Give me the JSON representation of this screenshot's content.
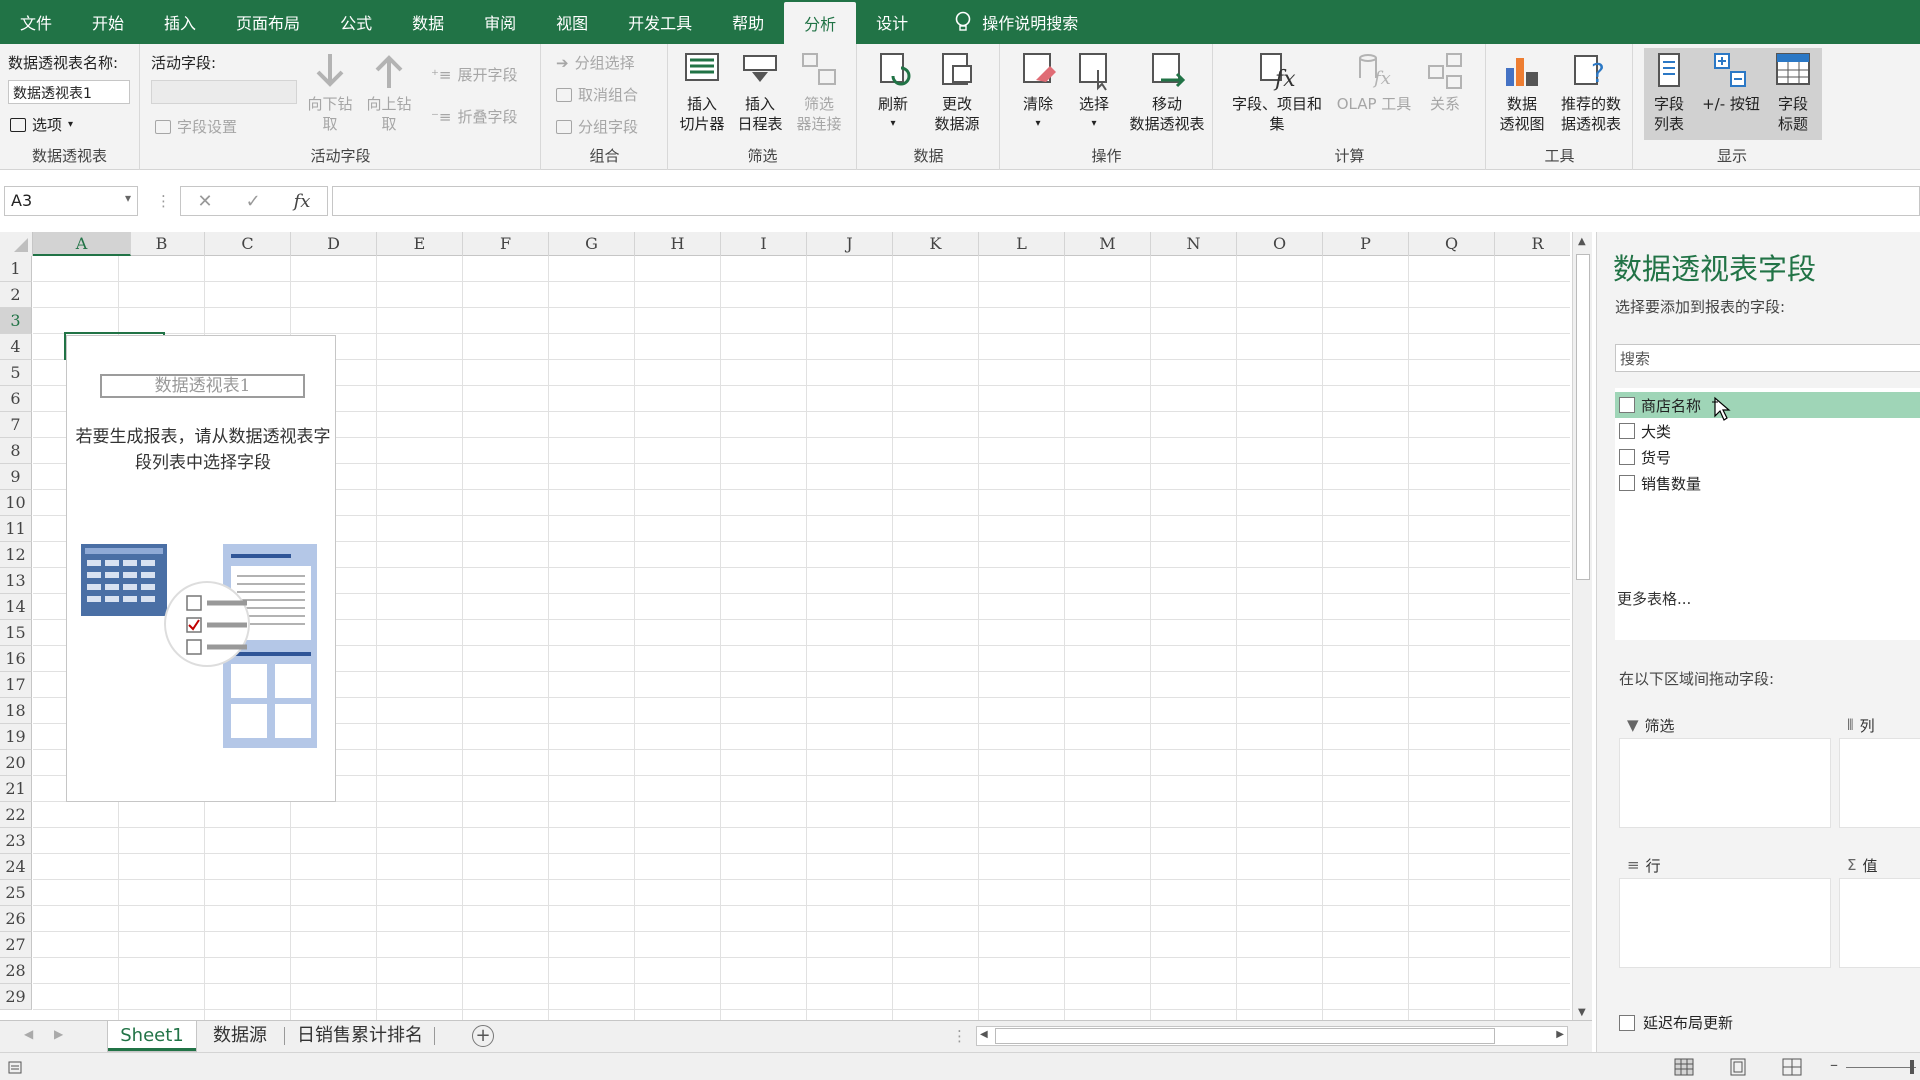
{
  "ribbon_tabs": [
    "文件",
    "开始",
    "插入",
    "页面布局",
    "公式",
    "数据",
    "审阅",
    "视图",
    "开发工具",
    "帮助",
    "分析",
    "设计"
  ],
  "active_tab": "分析",
  "tell_me": "操作说明搜索",
  "groups": {
    "pivot": {
      "label": "数据透视表",
      "name_label": "数据透视表名称:",
      "name_value": "数据透视表1",
      "options": "选项"
    },
    "active_field": {
      "label": "活动字段",
      "field_label": "活动字段:",
      "settings": "字段设置",
      "drill_down": "向下钻取",
      "drill_up_1": "向上钻",
      "drill_up_2": "取",
      "expand": "展开字段",
      "collapse": "折叠字段"
    },
    "group": {
      "label": "组合",
      "group_sel": "分组选择",
      "ungroup": "取消组合",
      "group_field": "分组字段"
    },
    "filter": {
      "label": "筛选",
      "slicer_1": "插入",
      "slicer_2": "切片器",
      "timeline_1": "插入",
      "timeline_2": "日程表",
      "conn_1": "筛选",
      "conn_2": "器连接"
    },
    "data": {
      "label": "数据",
      "refresh": "刷新",
      "change_1": "更改",
      "change_2": "数据源"
    },
    "actions": {
      "label": "操作",
      "clear": "清除",
      "select": "选择",
      "move_1": "移动",
      "move_2": "数据透视表"
    },
    "calc": {
      "label": "计算",
      "fields_1": "字段、项目和",
      "fields_2": "集",
      "olap": "OLAP 工具",
      "rel": "关系"
    },
    "tools": {
      "label": "工具",
      "chart_1": "数据",
      "chart_2": "透视图",
      "rec_1": "推荐的数",
      "rec_2": "据透视表"
    },
    "show": {
      "label": "显示",
      "list_1": "字段",
      "list_2": "列表",
      "btn": "+/- 按钮",
      "hdr_1": "字段",
      "hdr_2": "标题"
    }
  },
  "namebox": "A3",
  "columns": [
    "A",
    "B",
    "C",
    "D",
    "E",
    "F",
    "G",
    "H",
    "I",
    "J",
    "K",
    "L",
    "M",
    "N",
    "O",
    "P",
    "Q",
    "R"
  ],
  "rows": [
    "1",
    "2",
    "3",
    "4",
    "5",
    "6",
    "7",
    "8",
    "9",
    "10",
    "11",
    "12",
    "13",
    "14",
    "15",
    "16",
    "17",
    "18",
    "19",
    "20",
    "21",
    "22",
    "23",
    "24",
    "25",
    "26",
    "27",
    "28",
    "29"
  ],
  "pivot_placeholder": {
    "title": "数据透视表1",
    "message": "若要生成报表，请从数据透视表字段列表中选择字段"
  },
  "sheets": [
    "Sheet1",
    "数据源",
    "日销售累计排名"
  ],
  "active_sheet": "Sheet1",
  "pane": {
    "title": "数据透视表字段",
    "subtitle": "选择要添加到报表的字段:",
    "search_placeholder": "搜索",
    "fields": [
      "商店名称",
      "大类",
      "货号",
      "销售数量"
    ],
    "more_tables": "更多表格...",
    "drag_hint": "在以下区域间拖动字段:",
    "areas": {
      "filter": "筛选",
      "columns": "列",
      "rows": "行",
      "values": "值"
    },
    "defer": "延迟布局更新"
  },
  "colors": {
    "accent": "#217346",
    "highlight": "#9fd5b7"
  }
}
